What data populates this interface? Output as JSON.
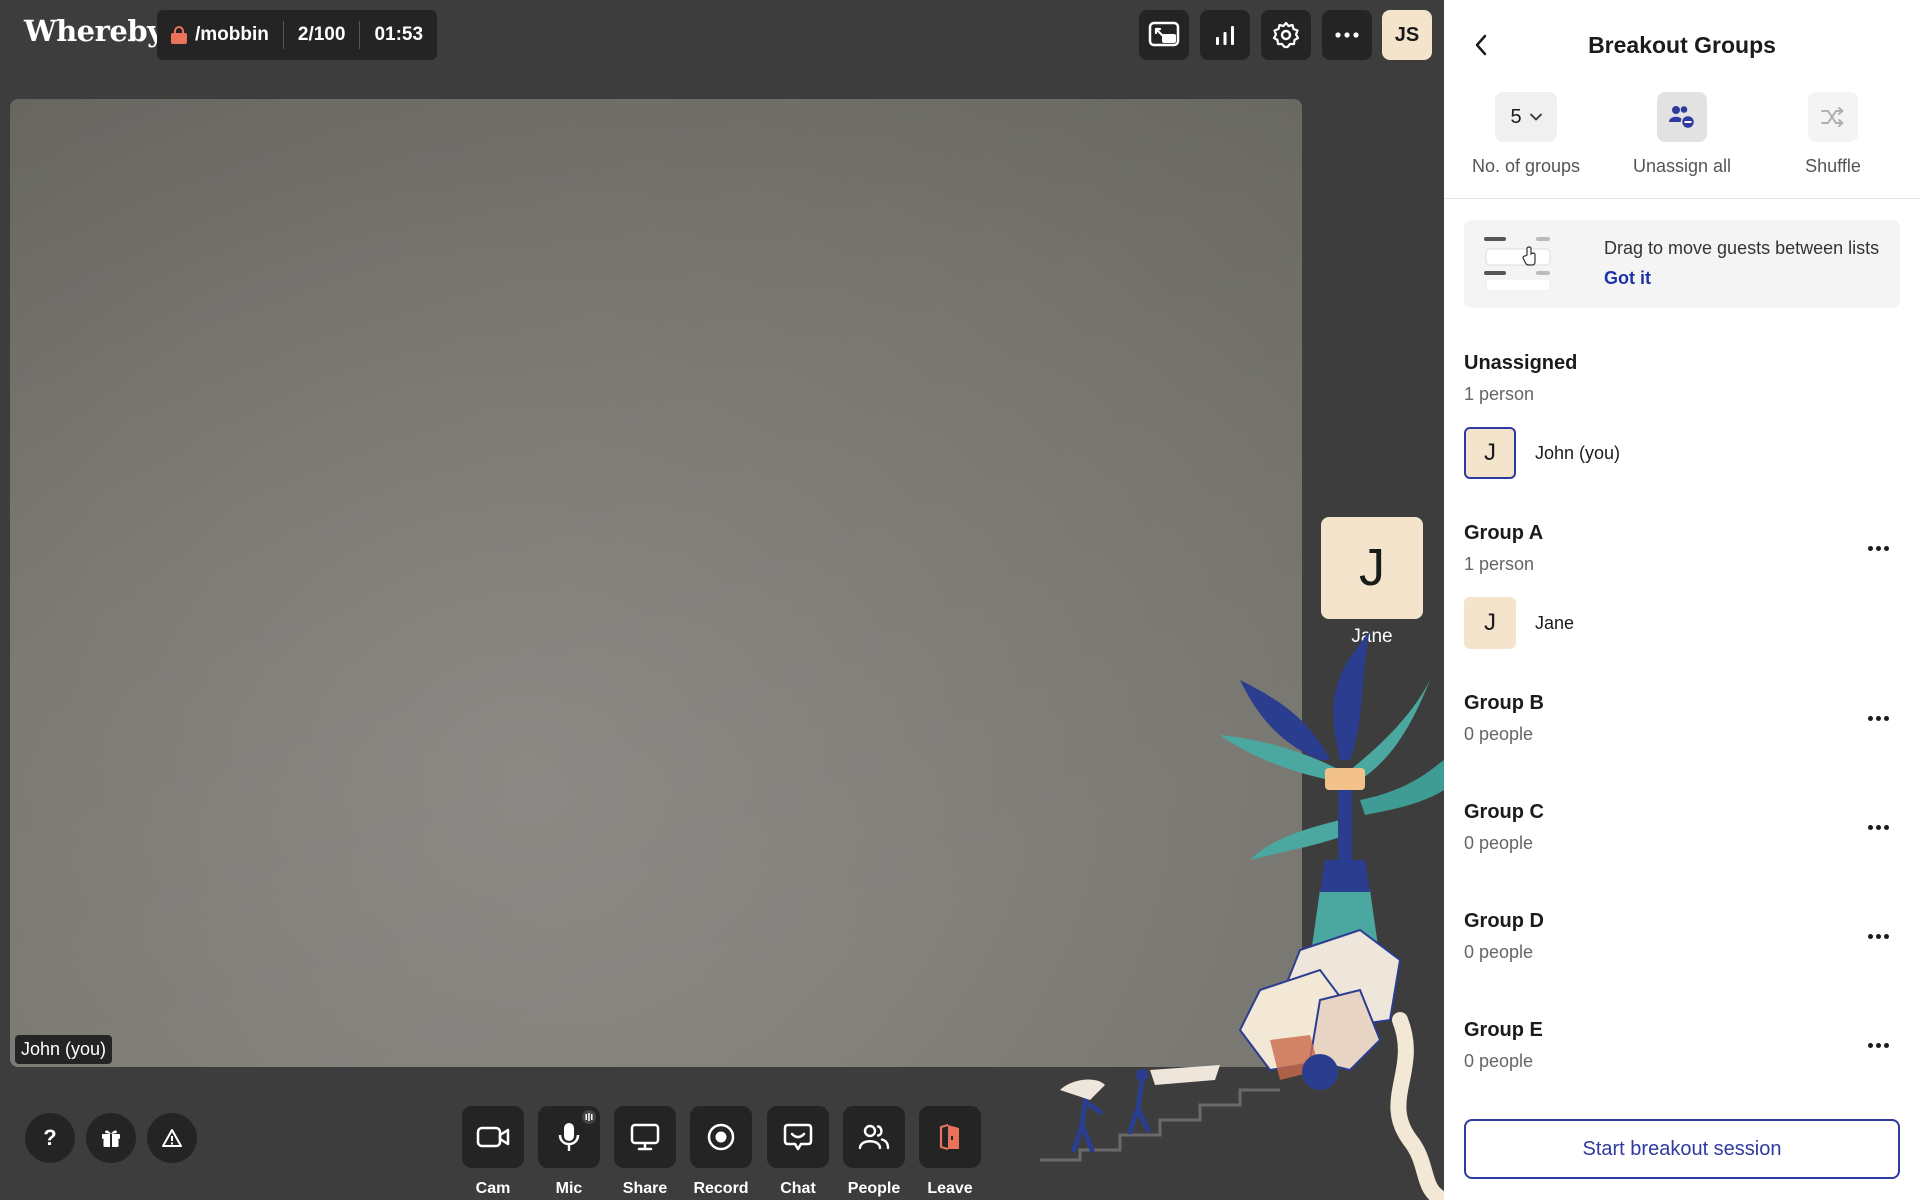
{
  "app": {
    "logo": "Whereby"
  },
  "room": {
    "name": "/mobbin",
    "count": "2/100",
    "timer": "01:53"
  },
  "user": {
    "initials": "JS"
  },
  "video": {
    "self_label": "John (you)"
  },
  "participant": {
    "initial": "J",
    "name": "Jane"
  },
  "toolbar": {
    "cam": "Cam",
    "mic": "Mic",
    "share": "Share",
    "record": "Record",
    "chat": "Chat",
    "people": "People",
    "leave": "Leave"
  },
  "help": {
    "question": "?"
  },
  "panel": {
    "title": "Breakout Groups",
    "controls": {
      "groups_value": "5",
      "groups_label": "No. of groups",
      "unassign_label": "Unassign all",
      "shuffle_label": "Shuffle"
    },
    "hint": {
      "text": "Drag to move guests between lists",
      "link": "Got it"
    },
    "unassigned": {
      "title": "Unassigned",
      "count": "1 person",
      "members": [
        {
          "initial": "J",
          "name": "John (you)"
        }
      ]
    },
    "groups": [
      {
        "title": "Group A",
        "count": "1 person",
        "members": [
          {
            "initial": "J",
            "name": "Jane"
          }
        ]
      },
      {
        "title": "Group B",
        "count": "0 people"
      },
      {
        "title": "Group C",
        "count": "0 people"
      },
      {
        "title": "Group D",
        "count": "0 people"
      },
      {
        "title": "Group E",
        "count": "0 people"
      }
    ],
    "start_label": "Start breakout session"
  },
  "colors": {
    "accent": "#2f3aa0",
    "tile": "#f4e4cc",
    "leave": "#e8735a",
    "dark": "#242424"
  }
}
